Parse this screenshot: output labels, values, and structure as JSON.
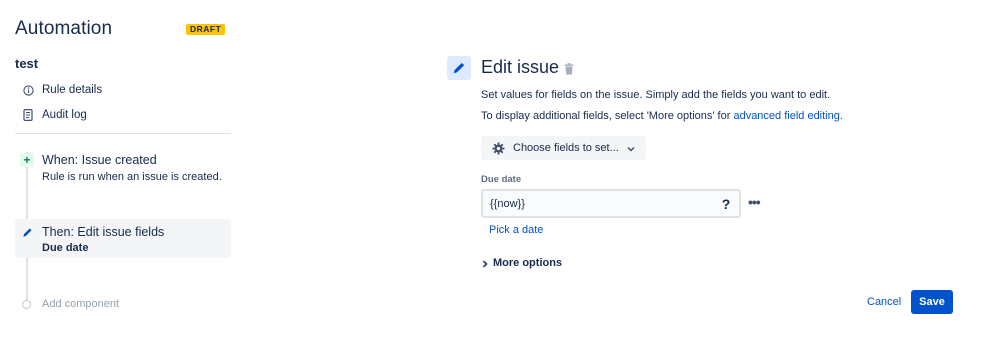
{
  "sidebar": {
    "title": "Automation",
    "badge": "DRAFT",
    "rule_name": "test",
    "links": [
      {
        "label": "Rule details",
        "icon": "info-icon"
      },
      {
        "label": "Audit log",
        "icon": "document-icon"
      }
    ],
    "trigger": {
      "title": "When: Issue created",
      "subtitle": "Rule is run when an issue is created.",
      "icon": "plus-icon"
    },
    "action": {
      "title": "Then: Edit issue fields",
      "subtitle": "Due date",
      "icon": "pencil-icon"
    },
    "add_component": "Add component"
  },
  "main": {
    "title": "Edit issue",
    "description": "Set values for fields on the issue. Simply add the fields you want to edit.",
    "info_prefix": "To display additional fields, select 'More options' for ",
    "info_link": "advanced field editing.",
    "choose_fields": "Choose fields to set...",
    "field": {
      "label": "Due date",
      "value": "{{now}}",
      "help": "?",
      "more": "•••",
      "pick_link": "Pick a date"
    },
    "more_options": "More options",
    "cancel": "Cancel",
    "save": "Save"
  },
  "colors": {
    "accent": "#0052CC",
    "draft_badge": "#FFC400",
    "trigger_bg": "#E3FCEF",
    "trigger_fg": "#00875A",
    "selected_bg": "#F4F5F7"
  }
}
